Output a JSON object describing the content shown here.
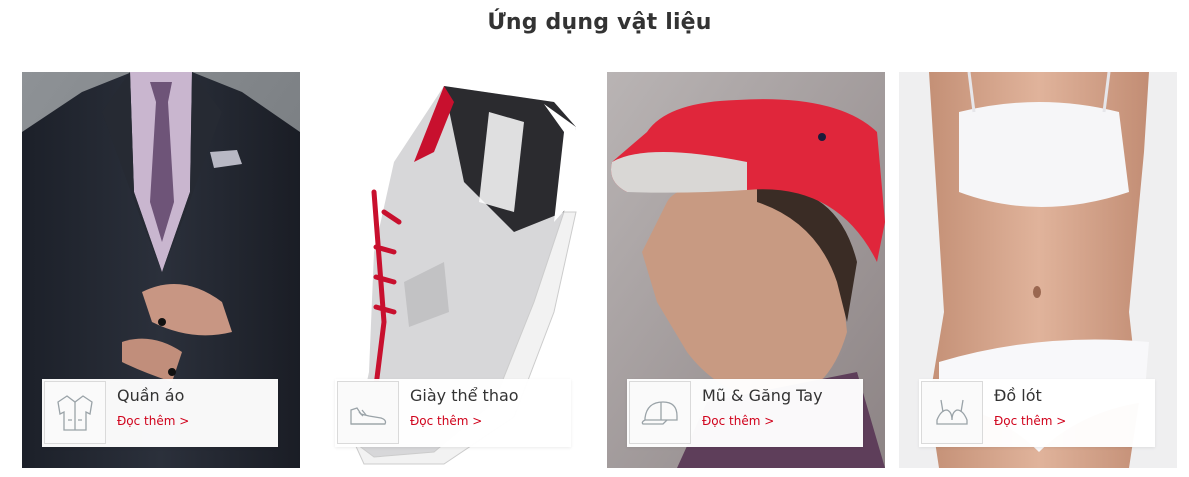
{
  "section": {
    "title": "Ứng dụng vật liệu"
  },
  "cards": [
    {
      "label": "Quần áo",
      "more": "Đọc thêm >",
      "icon": "jacket-icon",
      "image": "suit-photo"
    },
    {
      "label": "Giày thể thao",
      "more": "Đọc thêm >",
      "icon": "sneaker-icon",
      "image": "sneaker-photo"
    },
    {
      "label": "Mũ & Găng Tay",
      "more": "Đọc thêm >",
      "icon": "cap-icon",
      "image": "red-cap-photo"
    },
    {
      "label": "Đồ lót",
      "more": "Đọc thêm >",
      "icon": "bra-icon",
      "image": "underwear-photo"
    }
  ],
  "colors": {
    "link": "#d0021b",
    "title": "#333333",
    "icon_stroke": "#9aa3a8"
  }
}
